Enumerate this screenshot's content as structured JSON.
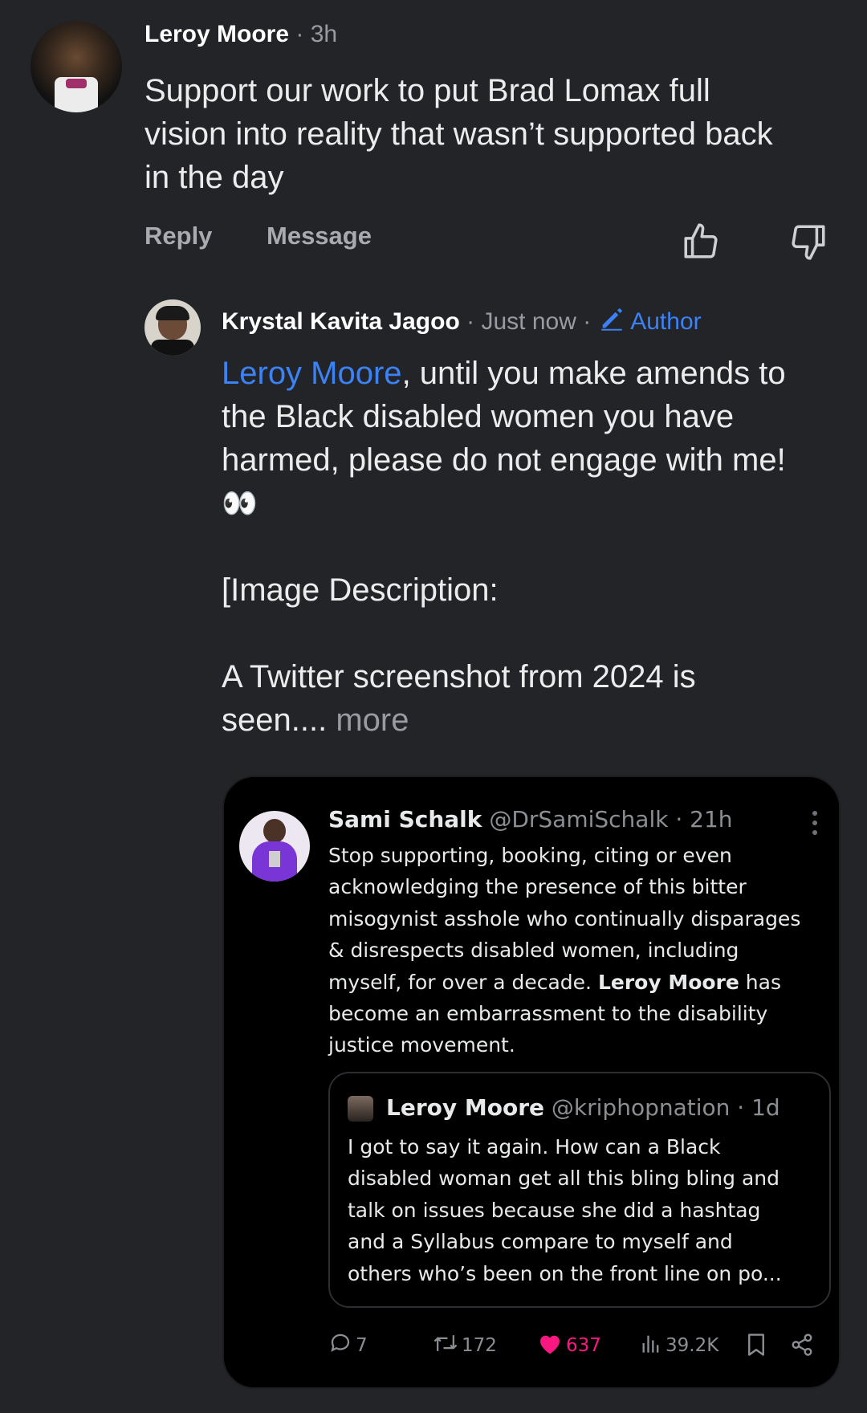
{
  "comment": {
    "author": "Leroy Moore",
    "separator": "·",
    "time": "3h",
    "text_lines": [
      "Support our work to put Brad Lomax full",
      "vision into reality that wasn’t supported back",
      "in the day"
    ],
    "reply_label": "Reply",
    "message_label": "Message"
  },
  "reply": {
    "author": "Krystal Kavita Jagoo",
    "meta_sep1": "·",
    "time": "Just now",
    "meta_sep2": "·",
    "author_badge": "Author",
    "mention": "Leroy Moore",
    "line1_rest": ", until you make amends to",
    "line2": "the Black disabled women you have",
    "line3": "harmed, please do not engage with me!",
    "emoji": "👀",
    "desc_heading": "[Image Description:",
    "desc_line1": "A Twitter screenshot from 2024 is",
    "desc_line2": "seen....",
    "more_label": "more"
  },
  "tweet": {
    "author": "Sami Schalk",
    "handle": "@DrSamiSchalk",
    "sep": "·",
    "time": "21h",
    "lines": [
      "Stop supporting, booking, citing or even",
      "acknowledging the presence of this bitter",
      "misogynist asshole who continually disparages",
      "& disrespects disabled women, including"
    ],
    "line5_start": "myself, for over a decade. ",
    "line5_bold": "Leroy Moore",
    "line5_end": " has",
    "line6": "become an embarrassment to the disability",
    "line7": "justice movement.",
    "quoted": {
      "author": "Leroy Moore",
      "handle": "@kriphopnation",
      "sep": "·",
      "time": "1d",
      "lines": [
        "I got to say it again.  How can a Black",
        "disabled woman get all this bling bling and",
        "talk on issues because she did a hashtag",
        "and a Syllabus compare to myself and",
        "others who’s been on the front line on po..."
      ]
    },
    "stats": {
      "replies": "7",
      "retweets": "172",
      "likes": "637",
      "views": "39.2K"
    }
  },
  "colors": {
    "background": "#232428",
    "link": "#3b82f6",
    "like": "#f91880"
  }
}
